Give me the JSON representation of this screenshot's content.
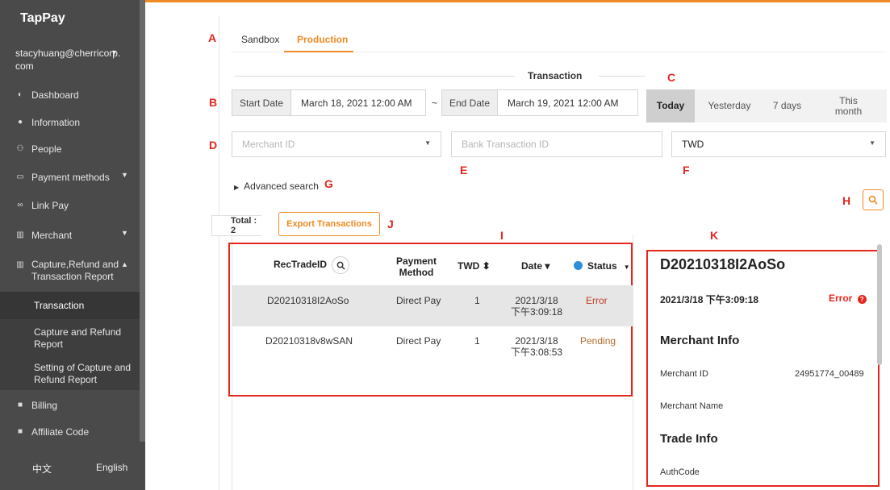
{
  "sidebar": {
    "logo": "TapPay",
    "user": "stacyhuang@cherricorp.\ncom",
    "items": [
      {
        "label": "Dashboard",
        "icon": "dashboard-icon"
      },
      {
        "label": "Information",
        "icon": "info-icon"
      },
      {
        "label": "People",
        "icon": "people-icon"
      },
      {
        "label": "Payment methods",
        "icon": "card-icon"
      },
      {
        "label": "Link Pay",
        "icon": "link-icon"
      },
      {
        "label": "Merchant",
        "icon": "merchant-icon"
      },
      {
        "label": "Capture,Refund and\nTransaction Report",
        "icon": "report-icon"
      },
      {
        "label": "Billing",
        "icon": "billing-icon"
      },
      {
        "label": "Affiliate Code",
        "icon": "affiliate-icon"
      }
    ],
    "sub_items": [
      "Transaction",
      "Capture and Refund\nReport",
      "Setting of Capture and\nRefund Report"
    ],
    "lang_zh": "中文",
    "lang_en": "English"
  },
  "markers": {
    "A": "A",
    "B": "B",
    "C": "C",
    "D": "D",
    "E": "E",
    "F": "F",
    "G": "G",
    "H": "H",
    "I": "I",
    "J": "J",
    "K": "K"
  },
  "tabs": [
    "Sandbox",
    "Production"
  ],
  "section_title": "Transaction",
  "dates": {
    "start_label": "Start Date",
    "start_value": "March 18, 2021 12:00 AM",
    "separator": "~",
    "end_label": "End Date",
    "end_value": "March 19, 2021 12:00 AM"
  },
  "quick_ranges": [
    "Today",
    "Yesterday",
    "7 days",
    "This\nmonth"
  ],
  "filters": {
    "merchant_placeholder": "Merchant ID",
    "bank_placeholder": "Bank Transaction ID",
    "currency": "TWD"
  },
  "advanced_search": "Advanced search",
  "total": "Total : 2",
  "export_label": "Export Transactions",
  "table": {
    "headers": [
      "RecTradeID",
      "Payment\nMethod",
      "TWD ⬍",
      "Date ▾",
      "Status"
    ],
    "rows": [
      {
        "id": "D20210318I2AoSo",
        "method": "Direct Pay",
        "amount": "1",
        "date": "2021/3/18\n下午3:09:18",
        "status": "Error"
      },
      {
        "id": "D20210318v8wSAN",
        "method": "Direct Pay",
        "amount": "1",
        "date": "2021/3/18\n下午3:08:53",
        "status": "Pending"
      }
    ]
  },
  "detail": {
    "title": "D20210318I2AoSo",
    "datetime": "2021/3/18 下午3:09:18",
    "status": "Error",
    "merchant_section": "Merchant Info",
    "merchant_id_label": "Merchant ID",
    "merchant_id_value": "24951774_00489",
    "merchant_name_label": "Merchant Name",
    "trade_section": "Trade Info",
    "authcode_label": "AuthCode"
  },
  "colors": {
    "accent": "#f08a24",
    "annotation": "#e5261f",
    "sidebar": "#4a4a4a"
  }
}
